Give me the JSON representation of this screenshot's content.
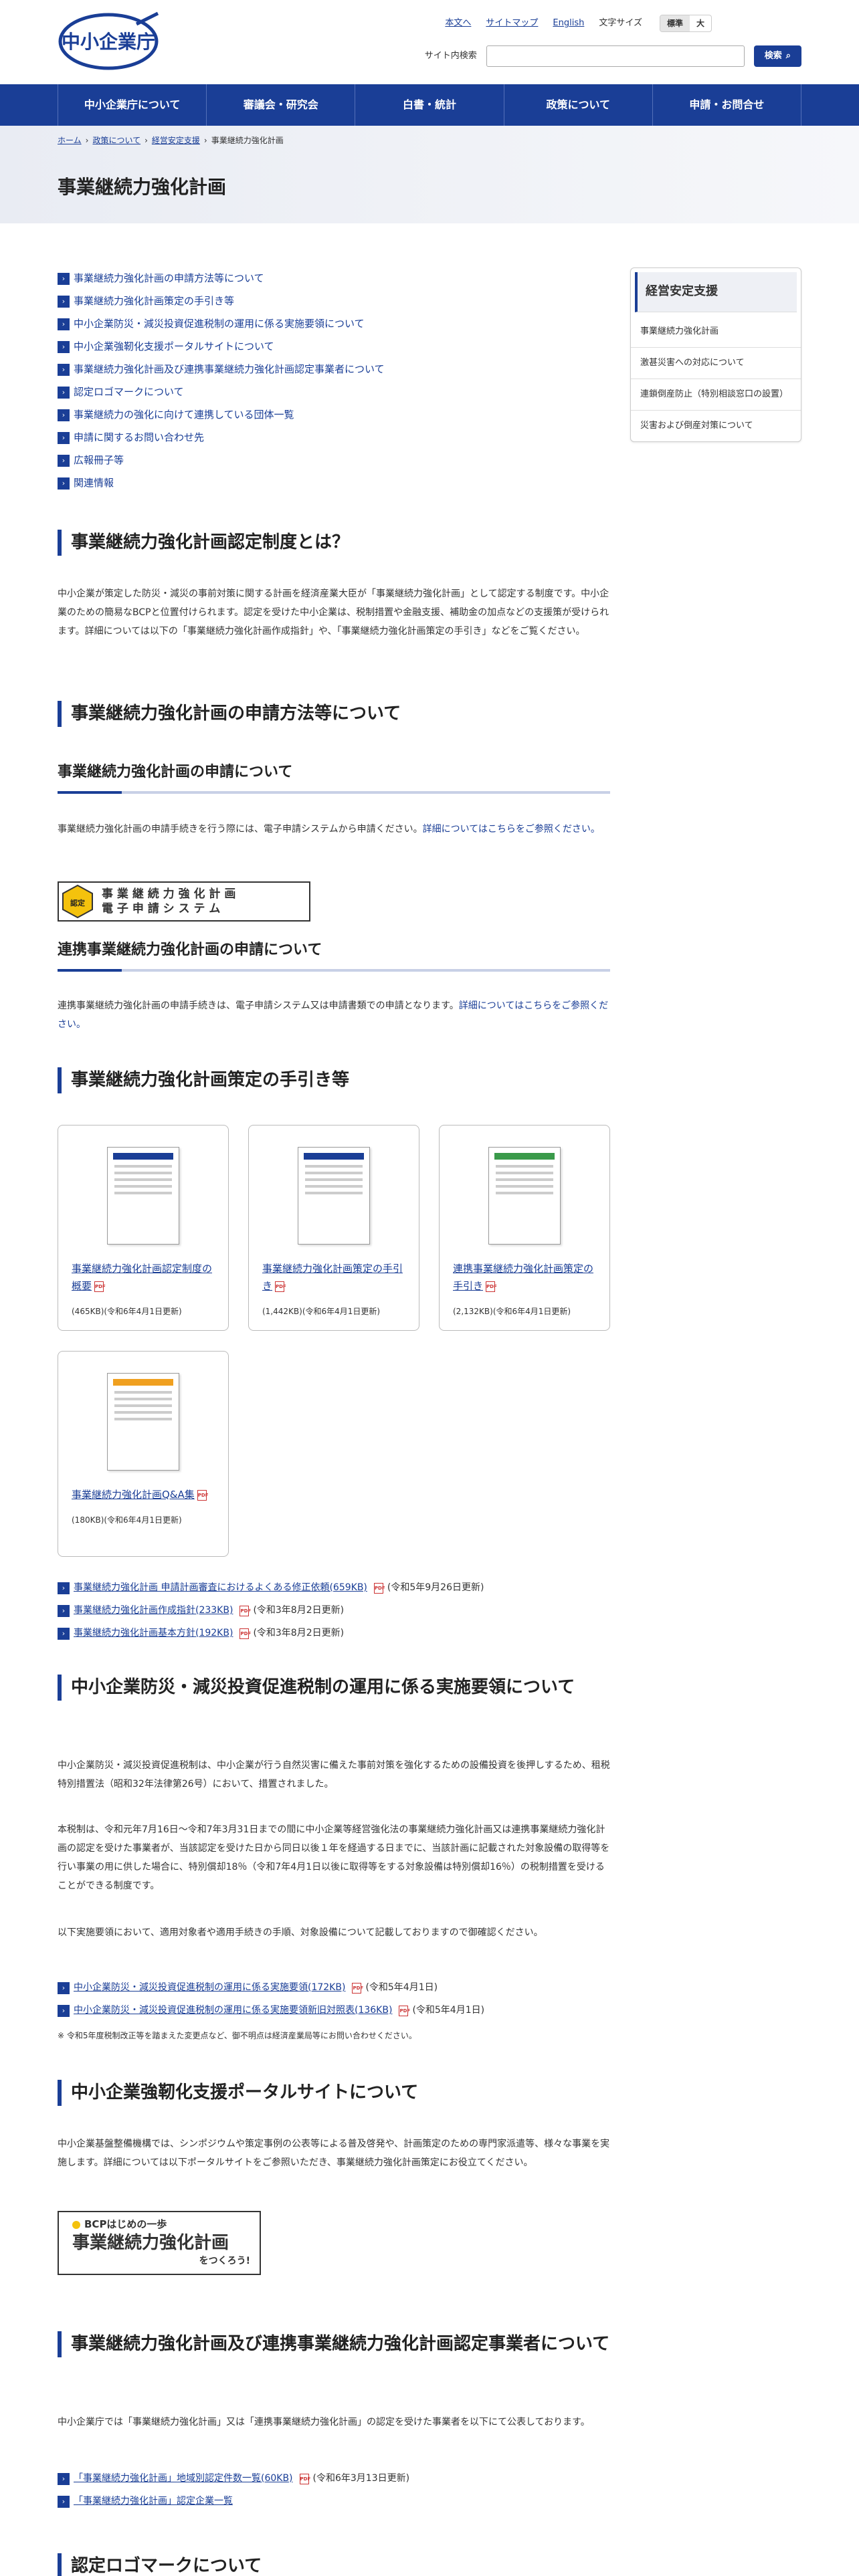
{
  "header": {
    "logo_text": "中小企業庁",
    "util_links": [
      "本文へ",
      "サイトマップ",
      "English"
    ],
    "font_size_label": "文字サイズ",
    "font_size_options": [
      "標準",
      "大"
    ],
    "search_label": "サイト内検索",
    "search_button": "検索"
  },
  "nav": [
    "中小企業庁について",
    "審議会・研究会",
    "白書・統計",
    "政策について",
    "申請・お問合せ"
  ],
  "breadcrumb": [
    "ホーム",
    "政策について",
    "経営安定支援",
    "事業継続力強化計画"
  ],
  "page_title": "事業継続力強化計画",
  "sidebar": {
    "title": "経営安定支援",
    "items": [
      "事業継続力強化計画",
      "激甚災害への対応について",
      "連鎖倒産防止（特別相談窓口の設置）",
      "災害および倒産対策について"
    ]
  },
  "toc": [
    "事業継続力強化計画の申請方法等について",
    "事業継続力強化計画策定の手引き等",
    "中小企業防災・減災投資促進税制の運用に係る実施要領について",
    "中小企業強靭化支援ポータルサイトについて",
    "事業継続力強化計画及び連携事業継続力強化計画認定事業者について",
    "認定ロゴマークについて",
    "事業継続力の強化に向けて連携している団体一覧",
    "申請に関するお問い合わせ先",
    "広報冊子等",
    "関連情報"
  ],
  "s1": {
    "title": "事業継続力強化計画認定制度とは？",
    "body": "中小企業が策定した防災・減災の事前対策に関する計画を経済産業大臣が「事業継続力強化計画」として認定する制度です。中小企業のための簡易なBCPと位置付けられます。認定を受けた中小企業は、税制措置や金融支援、補助金の加点などの支援策が受けられます。詳細については以下の「事業継続力強化計画作成指針」や、「事業継続力強化計画策定の手引き」などをご覧ください。"
  },
  "s2": {
    "title": "事業継続力強化計画の申請方法等について",
    "sub1": "事業継続力強化計画の申請について",
    "sub1_body": "事業継続力強化計画の申請手続きを行う際には、電子申請システムから申請ください。",
    "sub1_link": "詳細についてはこちらをご参照ください。",
    "banner_line1": "事 業 継 続 力 強 化 計 画",
    "banner_line2": "電 子 申 請 シ ス テ ム",
    "banner_badge": "認定",
    "sub2": "連携事業継続力強化計画の申請について",
    "sub2_body": "連携事業継続力強化計画の申請手続きは、電子申請システム又は申請書類での申請となります。",
    "sub2_link": "詳細についてはこちらをご参照ください。"
  },
  "s3": {
    "title": "事業継続力強化計画策定の手引き等",
    "cards": [
      {
        "title": "事業継続力強化計画認定制度の概要",
        "meta": "(465KB)(令和6年4月1日更新)",
        "accent": "#1a3e96"
      },
      {
        "title": "事業継続力強化計画策定の手引き",
        "meta": "(1,442KB)(令和6年4月1日更新)",
        "accent": "#1a3e96"
      },
      {
        "title": "連携事業継続力強化計画策定の手引き",
        "meta": "(2,132KB)(令和6年4月1日更新)",
        "accent": "#3a9a4a"
      },
      {
        "title": "事業継続力強化計画Q&A集",
        "meta": "(180KB)(令和6年4月1日更新)",
        "accent": "#f0a020"
      }
    ],
    "links": [
      {
        "label": "事業継続力強化計画 申請計画審査におけるよくある修正依頼(659KB)",
        "note": "(令和5年9月26日更新)"
      },
      {
        "label": "事業継続力強化計画作成指針(233KB)",
        "note": "(令和3年8月2日更新)"
      },
      {
        "label": "事業継続力強化計画基本方針(192KB)",
        "note": "(令和3年8月2日更新)"
      }
    ]
  },
  "s4": {
    "title": "中小企業防災・減災投資促進税制の運用に係る実施要領について",
    "p1": "中小企業防災・減災投資促進税制は、中小企業が行う自然災害に備えた事前対策を強化するための設備投資を後押しするため、租税特別措置法（昭和32年法律第26号）において、措置されました。",
    "p2": "本税制は、令和元年7月16日～令和7年3月31日までの間に中小企業等経営強化法の事業継続力強化計画又は連携事業継続力強化計画の認定を受けた事業者が、当該認定を受けた日から同日以後１年を経過する日までに、当該計画に記載された対象設備の取得等を行い事業の用に供した場合に、特別償却18％（令和7年4月1日以後に取得等をする対象設備は特別償却16％）の税制措置を受けることができる制度です。",
    "p3": "以下実施要領において、適用対象者や適用手続きの手順、対象設備について記載しておりますので御確認ください。",
    "links": [
      {
        "label": "中小企業防災・減災投資促進税制の運用に係る実施要領(172KB)",
        "note": "(令和5年4月1日)"
      },
      {
        "label": "中小企業防災・減災投資促進税制の運用に係る実施要領新旧対照表(136KB)",
        "note": "(令和5年4月1日)"
      }
    ],
    "note": "※ 令和5年度税制改正等を踏まえた変更点など、御不明点は経済産業局等にお問い合わせください。"
  },
  "s5": {
    "title": "中小企業強靭化支援ポータルサイトについて",
    "body": "中小企業基盤整備機構では、シンポジウムや策定事例の公表等による普及啓発や、計画策定のための専門家派遣等、様々な事業を実施します。詳細については以下ポータルサイトをご参照いただき、事業継続力強化計画策定にお役立てください。",
    "banner_top": "BCPはじめの一歩",
    "banner_main": "事業継続力強化計画",
    "banner_sub": "をつくろう!"
  },
  "s6": {
    "title": "事業継続力強化計画及び連携事業継続力強化計画認定事業者について",
    "body": "中小企業庁では「事業継続力強化計画」又は「連携事業継続力強化計画」の認定を受けた事業者を以下にて公表しております。",
    "links": [
      {
        "label": "「事業継続力強化計画」地域別認定件数一覧(60KB)",
        "note": "(令和6年3月13日更新)",
        "pdf": true
      },
      {
        "label": "「事業継続力強化計画」認定企業一覧",
        "note": "",
        "pdf": false
      }
    ]
  },
  "s7": {
    "title": "認定ロゴマークについて"
  }
}
